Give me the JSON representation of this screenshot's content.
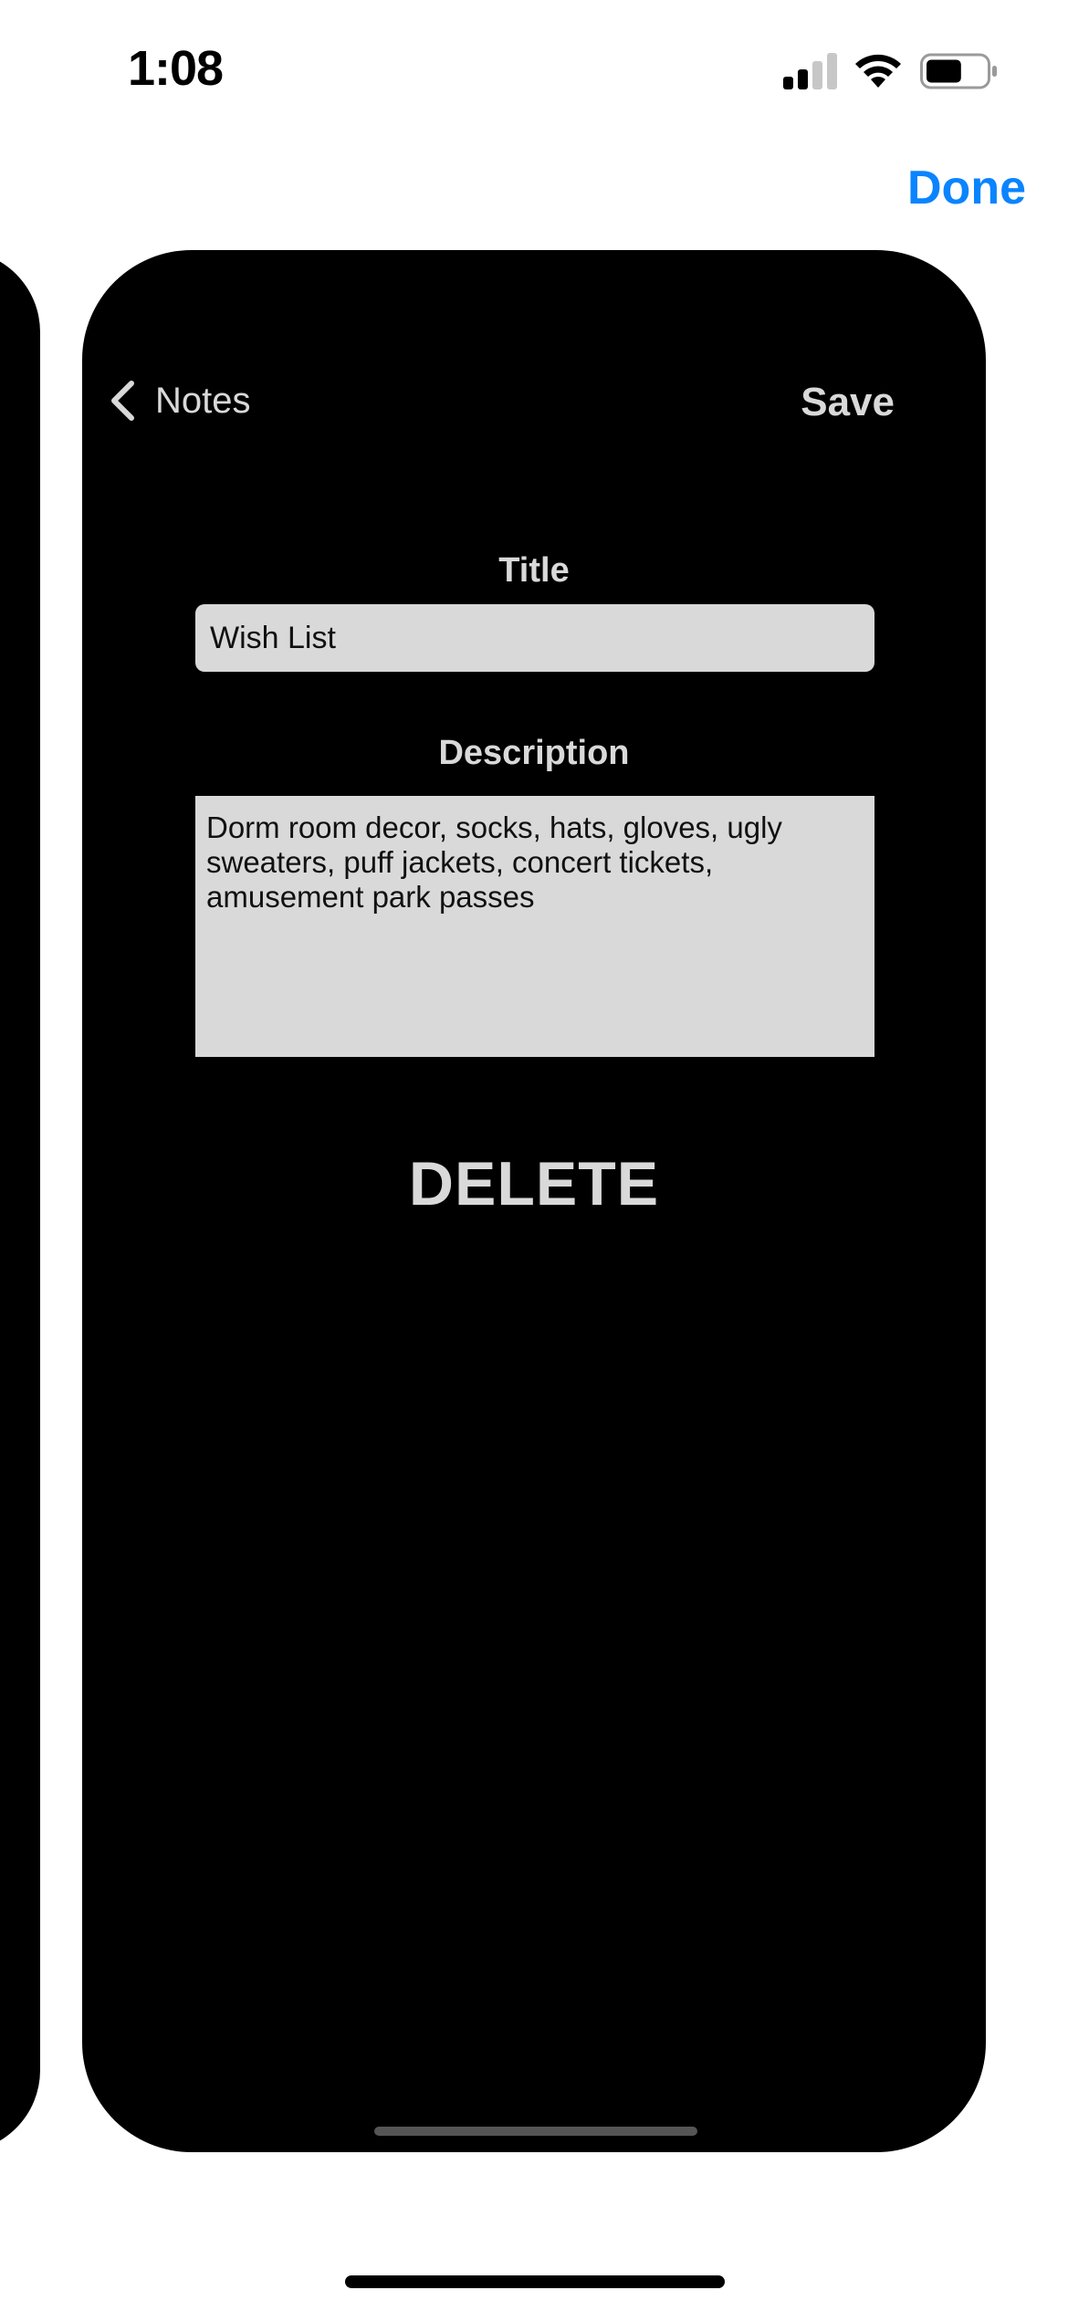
{
  "status_bar": {
    "time": "1:08",
    "signal_icon": "cellular-signal-icon",
    "wifi_icon": "wifi-icon",
    "battery_icon": "battery-icon",
    "battery_level": 0.6
  },
  "top_bar": {
    "done_label": "Done"
  },
  "colors": {
    "accent": "#0a84ff",
    "card_background": "#000000",
    "field_background": "#d9d9d9",
    "text_light": "#d9d9d9"
  },
  "editor": {
    "back_label": "Notes",
    "back_icon": "chevron-left-icon",
    "save_label": "Save",
    "title_label": "Title",
    "title_value": "Wish List",
    "description_label": "Description",
    "description_value": "Dorm room decor, socks, hats, gloves, ugly sweaters, puff jackets, concert tickets, amusement park passes",
    "delete_label": "DELETE"
  }
}
